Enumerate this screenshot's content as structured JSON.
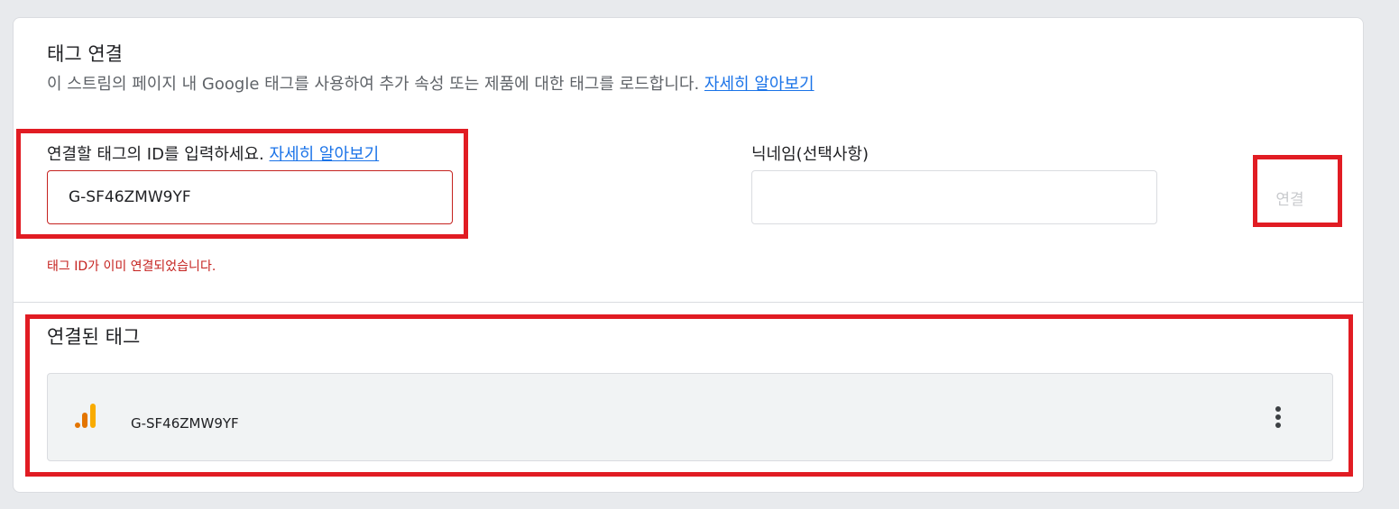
{
  "header": {
    "title": "태그 연결",
    "description": "이 스트림의 페이지 내 Google 태그를 사용하여 추가 속성 또는 제품에 대한 태그를 로드합니다.",
    "learn_more": "자세히 알아보기"
  },
  "form": {
    "tag_id_label": "연결할 태그의 ID를 입력하세요.",
    "tag_id_learn_more": "자세히 알아보기",
    "tag_id_value": "G-SF46ZMW9YF",
    "nickname_label": "닉네임(선택사항)",
    "nickname_value": "",
    "connect_button": "연결",
    "error": "태그 ID가 이미 연결되었습니다."
  },
  "connected": {
    "title": "연결된 태그",
    "tags": [
      {
        "id": "G-SF46ZMW9YF",
        "icon": "google-analytics-icon"
      }
    ],
    "more_icon": "more-vert-icon"
  },
  "colors": {
    "link": "#1a73e8",
    "error": "#c5221f",
    "highlight": "#e11c23",
    "ga_orange_dark": "#e37400",
    "ga_orange_light": "#f9ab00"
  }
}
